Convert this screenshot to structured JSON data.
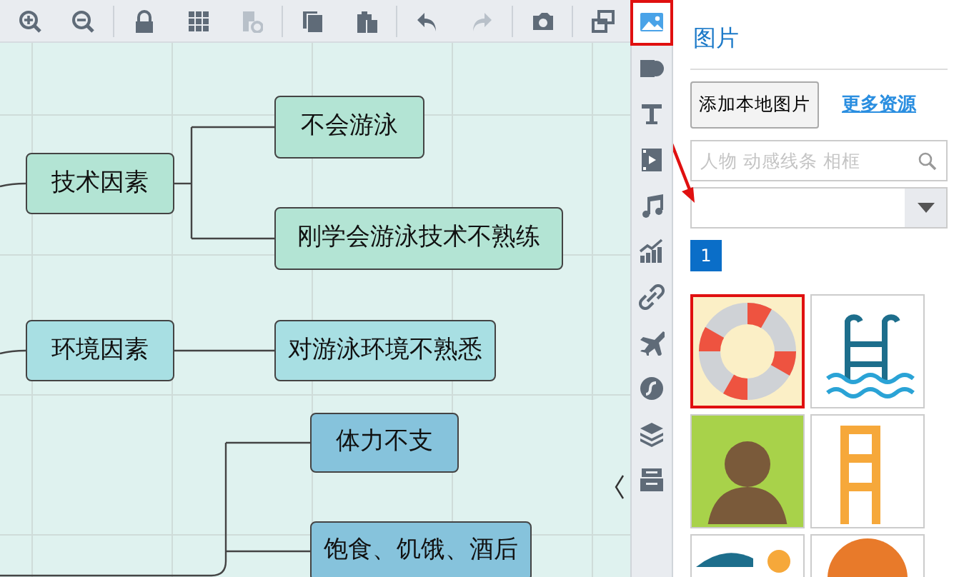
{
  "toolbar": [
    {
      "kind": "zoom-in",
      "disabled": false
    },
    {
      "kind": "zoom-out",
      "disabled": false
    },
    {
      "kind": "sep"
    },
    {
      "kind": "lock",
      "disabled": false
    },
    {
      "kind": "grid",
      "disabled": false
    },
    {
      "kind": "page-settings",
      "disabled": true
    },
    {
      "kind": "sep"
    },
    {
      "kind": "copy",
      "disabled": false
    },
    {
      "kind": "paste",
      "disabled": false
    },
    {
      "kind": "sep"
    },
    {
      "kind": "undo",
      "disabled": false
    },
    {
      "kind": "redo",
      "disabled": true
    },
    {
      "kind": "sep"
    },
    {
      "kind": "camera",
      "disabled": false
    },
    {
      "kind": "sep"
    },
    {
      "kind": "window",
      "disabled": false
    }
  ],
  "mindmap": {
    "branches": [
      {
        "label": "技术因素",
        "color": "#b3e4d4",
        "children": [
          {
            "label": "不会游泳"
          },
          {
            "label": "刚学会游泳技术不熟练"
          }
        ]
      },
      {
        "label": "环境因素",
        "color": "#a8dfe3",
        "children": [
          {
            "label": "对游泳环境不熟悉"
          }
        ]
      },
      {
        "color": "#86c3dc",
        "children": [
          {
            "label": "体力不支"
          },
          {
            "label": "饱食、饥饿、酒后"
          }
        ]
      }
    ]
  },
  "side_tabs": [
    {
      "kind": "image",
      "selected": true
    },
    {
      "kind": "shape",
      "selected": false
    },
    {
      "kind": "text",
      "selected": false
    },
    {
      "kind": "video",
      "selected": false
    },
    {
      "kind": "music",
      "selected": false
    },
    {
      "kind": "chart",
      "selected": false
    },
    {
      "kind": "link",
      "selected": false
    },
    {
      "kind": "plane",
      "selected": false
    },
    {
      "kind": "flash",
      "selected": false
    },
    {
      "kind": "layers",
      "selected": false
    },
    {
      "kind": "archive",
      "selected": false
    }
  ],
  "panel": {
    "title": "图片",
    "add_button": "添加本地图片",
    "more_link": "更多资源",
    "search": {
      "placeholder": "人物 动感线条 相框"
    },
    "pages": [
      {
        "label": "1",
        "selected": true
      }
    ],
    "images": [
      {
        "kind": "lifebuoy",
        "selected": true
      },
      {
        "kind": "pool-ladder",
        "selected": false
      },
      {
        "kind": "person",
        "selected": false
      },
      {
        "kind": "ladder",
        "selected": false
      },
      {
        "kind": "wave",
        "selected": false
      },
      {
        "kind": "umbrella",
        "selected": false
      }
    ]
  }
}
